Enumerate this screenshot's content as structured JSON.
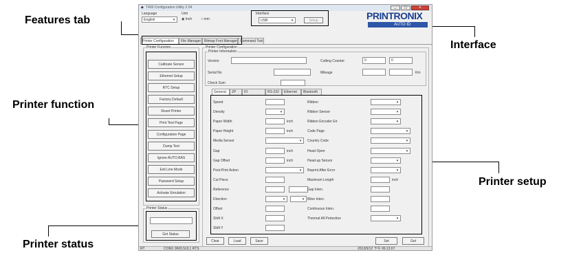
{
  "callouts": {
    "features_tab": "Features tab",
    "interface": "Interface",
    "printer_function": "Printer function",
    "printer_setup": "Printer setup",
    "printer_status": "Printer status"
  },
  "window": {
    "title": "T400 Configuration Utility 2.04",
    "language_label": "Language",
    "language_value": "English",
    "unit_label": "Unit",
    "unit_options": [
      "Inch",
      "mm"
    ],
    "interface_label": "Interface",
    "interface_value": "USB",
    "interface_setup_button": "Setup",
    "logo": "PRINTRONIX",
    "logo_sub": "AUTO ID",
    "controls": [
      "_",
      "▢",
      "✕"
    ]
  },
  "tabs": [
    "Printer Configuration",
    "File Manager",
    "Bitmap Font Manager",
    "Command Tool"
  ],
  "printer_function": {
    "group_label": "Printer Function",
    "buttons": [
      "Calibrate Sensor",
      "Ethernet Setup",
      "RTC Setup",
      "Factory Default",
      "Reset Printer",
      "Print Test Page",
      "Configuration Page",
      "Dump Text",
      "Ignore AUTO.BAS",
      "Exit Line Mode",
      "Password Setup",
      "Activate Emulation"
    ]
  },
  "printer_status": {
    "group_label": "Printer Status",
    "button": "Get Status"
  },
  "printer_config": {
    "group_label": "Printer Configuration",
    "info_label": "Printer Information",
    "version_label": "Version",
    "serial_label": "Serial No",
    "checksum_label": "Check Sum",
    "cutting_counter_label": "Cutting Counter",
    "cutting_counter_values": [
      "0",
      "0"
    ],
    "mileage_label": "Mileage",
    "mileage_unit": "Km",
    "sub_tabs": [
      "General",
      "ZP",
      "IO",
      "RS-232",
      "Ethernet",
      "Bluetooth"
    ],
    "left_fields": [
      {
        "label": "Speed",
        "type": "text"
      },
      {
        "label": "Density",
        "type": "combo"
      },
      {
        "label": "Paper Width",
        "type": "text",
        "unit": "inch"
      },
      {
        "label": "Paper Height",
        "type": "text",
        "unit": "inch"
      },
      {
        "label": "Media Sensor",
        "type": "combo_wide"
      },
      {
        "label": "Gap",
        "type": "text",
        "unit": "inch"
      },
      {
        "label": "Gap Offset",
        "type": "text",
        "unit": "inch"
      },
      {
        "label": "Post-Print Action",
        "type": "combo_wide"
      },
      {
        "label": "Cut Piece",
        "type": "text"
      },
      {
        "label": "Reference",
        "type": "text_pair"
      },
      {
        "label": "Direction",
        "type": "combo_pair"
      },
      {
        "label": "Offset",
        "type": "text"
      },
      {
        "label": "Shift X",
        "type": "text"
      },
      {
        "label": "Shift Y",
        "type": "text"
      }
    ],
    "right_fields": [
      {
        "label": "Ribbon",
        "type": "combo"
      },
      {
        "label": "Ribbon Sensor",
        "type": "combo"
      },
      {
        "label": "Ribbon Encoder Err",
        "type": "combo"
      },
      {
        "label": "Code Page",
        "type": "combo_wide"
      },
      {
        "label": "Country Code",
        "type": "combo_wide"
      },
      {
        "label": "Head Open",
        "type": "combo_wide"
      },
      {
        "label": "Head-up Sensor",
        "type": "combo"
      },
      {
        "label": "Reprint After Error",
        "type": "combo"
      },
      {
        "label": "Maximum Length",
        "type": "text",
        "unit": "inch"
      },
      {
        "label": "Gap Inten.",
        "type": "text"
      },
      {
        "label": "Bline Inten.",
        "type": "text"
      },
      {
        "label": "Continuous Inten.",
        "type": "text"
      },
      {
        "label": "Thermal All Protection",
        "type": "combo"
      }
    ],
    "bottom_buttons": [
      "Clear",
      "Load",
      "Save"
    ],
    "bottom_right_buttons": [
      "Set",
      "Get"
    ]
  },
  "status_bar": {
    "left": "RT",
    "middle": "COM1 9600,N,8,1 RTS",
    "right": "2013/5/12 下午 06:13:07"
  }
}
